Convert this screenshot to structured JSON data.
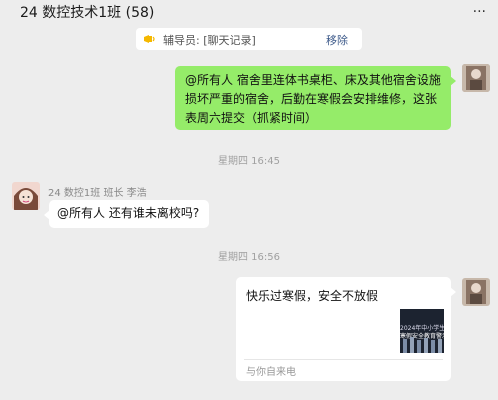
{
  "window": {
    "title": "24 数控技术1班 (58)"
  },
  "pinned": {
    "text": "辅导员: [聊天记录]",
    "action": "移除"
  },
  "messages": [
    {
      "id": "m1",
      "side": "right",
      "text_lines": [
        "@所有人 宿舍里连体书桌柜、床及其他宿舍设施",
        "损坏严重的宿舍，后勤在寒假会安排维修，这张",
        "表周六提交（抓紧时间）"
      ]
    },
    {
      "id": "m2",
      "side": "left",
      "sender": "24 数控1班 班长 李浩",
      "text": "@所有人 还有谁未离校吗?"
    },
    {
      "id": "m3",
      "side": "right",
      "type": "link-card",
      "title": "快乐过寒假，安全不放假",
      "thumb_lines": [
        "2024年中小学生",
        "寒假安全教育警示"
      ],
      "source": "与你自来电"
    }
  ],
  "timestamps": [
    "星期四 16:45",
    "星期四 16:56"
  ],
  "colors": {
    "background": "#ededed",
    "bubble_self": "#95ec69",
    "bubble_other": "#ffffff",
    "link": "#3d5a8a"
  },
  "icons": {
    "more": "more-icon",
    "pin": "announcement-icon"
  }
}
